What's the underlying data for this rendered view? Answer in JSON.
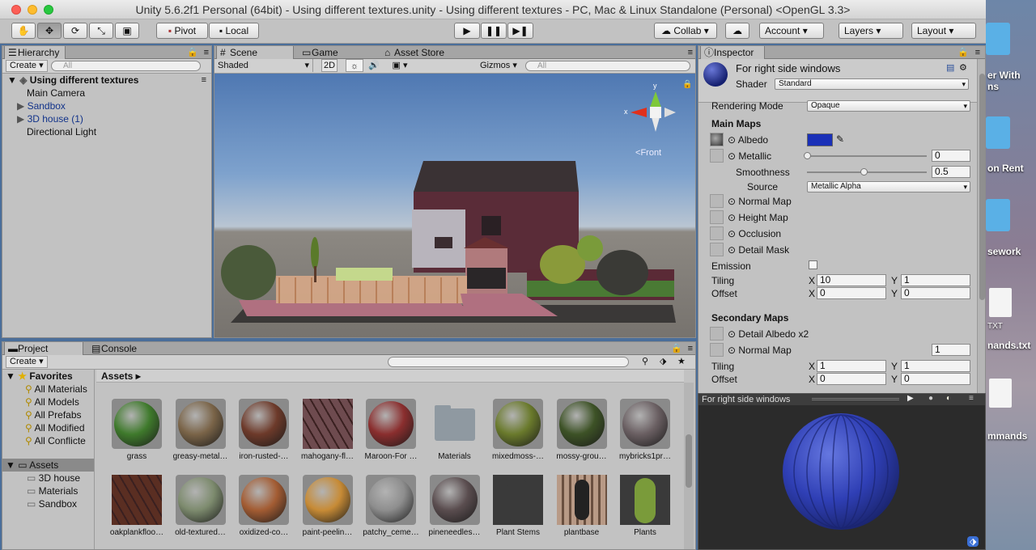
{
  "window": {
    "title": "Unity 5.6.2f1 Personal (64bit) - Using different textures.unity - Using different textures - PC, Mac & Linux Standalone (Personal) <OpenGL 3.3>"
  },
  "toolbar": {
    "pivot": "Pivot",
    "local": "Local",
    "collab": "Collab",
    "account": "Account",
    "layers": "Layers",
    "layout": "Layout"
  },
  "hierarchy": {
    "tab": "Hierarchy",
    "create": "Create",
    "search_placeholder": "All",
    "scene_name": "Using different textures",
    "items": [
      "Main Camera",
      "Sandbox",
      "3D house (1)",
      "Directional Light"
    ]
  },
  "scene_view": {
    "tabs": [
      "Scene",
      "Game",
      "Asset Store"
    ],
    "shading": "Shaded",
    "mode_2d": "2D",
    "gizmos": "Gizmos",
    "search_placeholder": "All",
    "axis_y": "y",
    "axis_x": "x",
    "view_label": "Front"
  },
  "project": {
    "tabs": [
      "Project",
      "Console"
    ],
    "create": "Create",
    "favorites_label": "Favorites",
    "favorites": [
      "All Materials",
      "All Models",
      "All Prefabs",
      "All Modified",
      "All Conflicte"
    ],
    "assets_label": "Assets",
    "asset_folders": [
      "3D house",
      "Materials",
      "Sandbox"
    ],
    "breadcrumb": "Assets",
    "assets": [
      {
        "name": "grass",
        "kind": "sphere",
        "color": "#3f7a2c"
      },
      {
        "name": "greasy-metal…",
        "kind": "sphere",
        "color": "#7a6448"
      },
      {
        "name": "iron-rusted-…",
        "kind": "sphere",
        "color": "#6d3a2a"
      },
      {
        "name": "mahogany-fl…",
        "kind": "plank",
        "color": "#6e4b4f"
      },
      {
        "name": "Maroon-For …",
        "kind": "sphere",
        "color": "#8a2e2e"
      },
      {
        "name": "Materials",
        "kind": "folder",
        "color": "#8f99a1"
      },
      {
        "name": "mixedmoss-…",
        "kind": "sphere",
        "color": "#6a7a2c"
      },
      {
        "name": "mossy-grou…",
        "kind": "sphere",
        "color": "#3d5226"
      },
      {
        "name": "mybricks1pr…",
        "kind": "sphere",
        "color": "#6a5f62"
      },
      {
        "name": "oakplankfloo…",
        "kind": "plank",
        "color": "#5a2e22"
      },
      {
        "name": "old-textured…",
        "kind": "sphere",
        "color": "#7d8b6e"
      },
      {
        "name": "oxidized-co…",
        "kind": "sphere",
        "color": "#a35c33"
      },
      {
        "name": "paint-peelin…",
        "kind": "sphere",
        "color": "#c78b36"
      },
      {
        "name": "patchy_ceme…",
        "kind": "sphere",
        "color": "#8e8e8e"
      },
      {
        "name": "pineneedles…",
        "kind": "sphere",
        "color": "#5a4d4f"
      },
      {
        "name": "Plant Stems",
        "kind": "leaf",
        "color": "#3a3a3a"
      },
      {
        "name": "plantbase",
        "kind": "stripes",
        "color": "#b89a86"
      },
      {
        "name": "Plants",
        "kind": "leaf",
        "color": "#7a9b3a"
      }
    ]
  },
  "inspector": {
    "tab": "Inspector",
    "material_name": "For right side windows",
    "shader_label": "Shader",
    "shader_value": "Standard",
    "rendering_mode_label": "Rendering Mode",
    "rendering_mode_value": "Opaque",
    "main_maps_label": "Main Maps",
    "albedo_label": "Albedo",
    "albedo_color": "#1a30b8",
    "metallic_label": "Metallic",
    "metallic_value": "0",
    "metallic_fraction": 0,
    "smoothness_label": "Smoothness",
    "smoothness_value": "0.5",
    "smoothness_fraction": 0.5,
    "source_label": "Source",
    "source_value": "Metallic Alpha",
    "normal_map_label": "Normal Map",
    "height_map_label": "Height Map",
    "occlusion_label": "Occlusion",
    "detail_mask_label": "Detail Mask",
    "emission_label": "Emission",
    "tiling_label": "Tiling",
    "offset_label": "Offset",
    "tiling_x": "10",
    "tiling_y": "1",
    "offset_x": "0",
    "offset_y": "0",
    "x_label": "X",
    "y_label": "Y",
    "secondary_maps_label": "Secondary Maps",
    "detail_albedo_label": "Detail Albedo x2",
    "secondary_normal_label": "Normal Map",
    "secondary_normal_value": "1",
    "sec_tiling_x": "1",
    "sec_tiling_y": "1",
    "sec_offset_x": "0",
    "sec_offset_y": "0",
    "preview_title": "For right side windows",
    "preview_color": "#2f3fb5"
  },
  "desktop": {
    "labels": [
      "er With",
      "ns",
      "on Rent",
      "sework",
      "TXT",
      "nands.txt",
      "mmands"
    ]
  }
}
